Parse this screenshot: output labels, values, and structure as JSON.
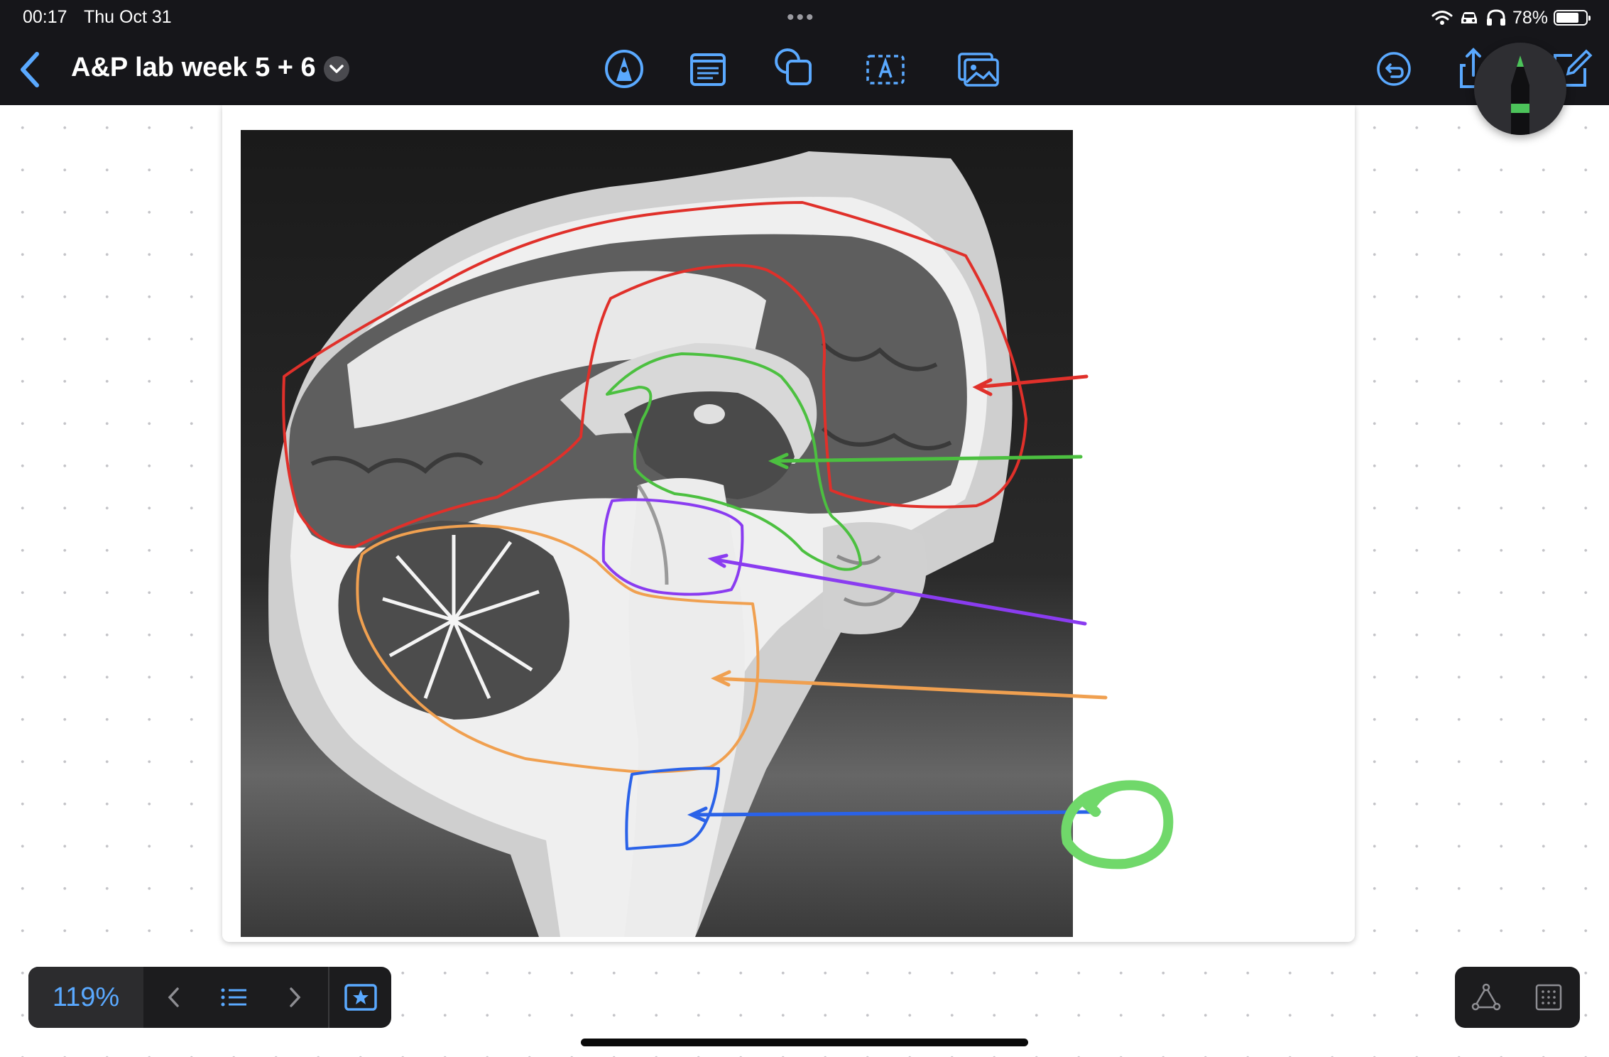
{
  "status_bar": {
    "time": "00:17",
    "date": "Thu Oct 31",
    "battery_percent": "78%",
    "battery_level": 0.78
  },
  "toolbar": {
    "title": "A&P lab week 5 + 6",
    "accent_color": "#5aa9ff",
    "tools": [
      "pen-tool-icon",
      "text-box-icon",
      "shapes-icon",
      "text-field-icon",
      "image-icon"
    ],
    "right_tools": [
      "undo-icon",
      "share-icon",
      "compose-icon"
    ]
  },
  "pencil": {
    "color": "#4cc35a"
  },
  "annotations": {
    "colors": {
      "red": "#e0302a",
      "green": "#4cc040",
      "purple": "#8a3cf0",
      "orange": "#f0a050",
      "blue": "#2a62e8",
      "light_green": "#70d86a"
    }
  },
  "bottom_bar": {
    "zoom": "119%",
    "left_buttons": [
      "previous-page-button",
      "page-list-button",
      "next-page-button",
      "favorite-button"
    ],
    "right_buttons": [
      "lasso-icon",
      "grid-icon"
    ]
  }
}
